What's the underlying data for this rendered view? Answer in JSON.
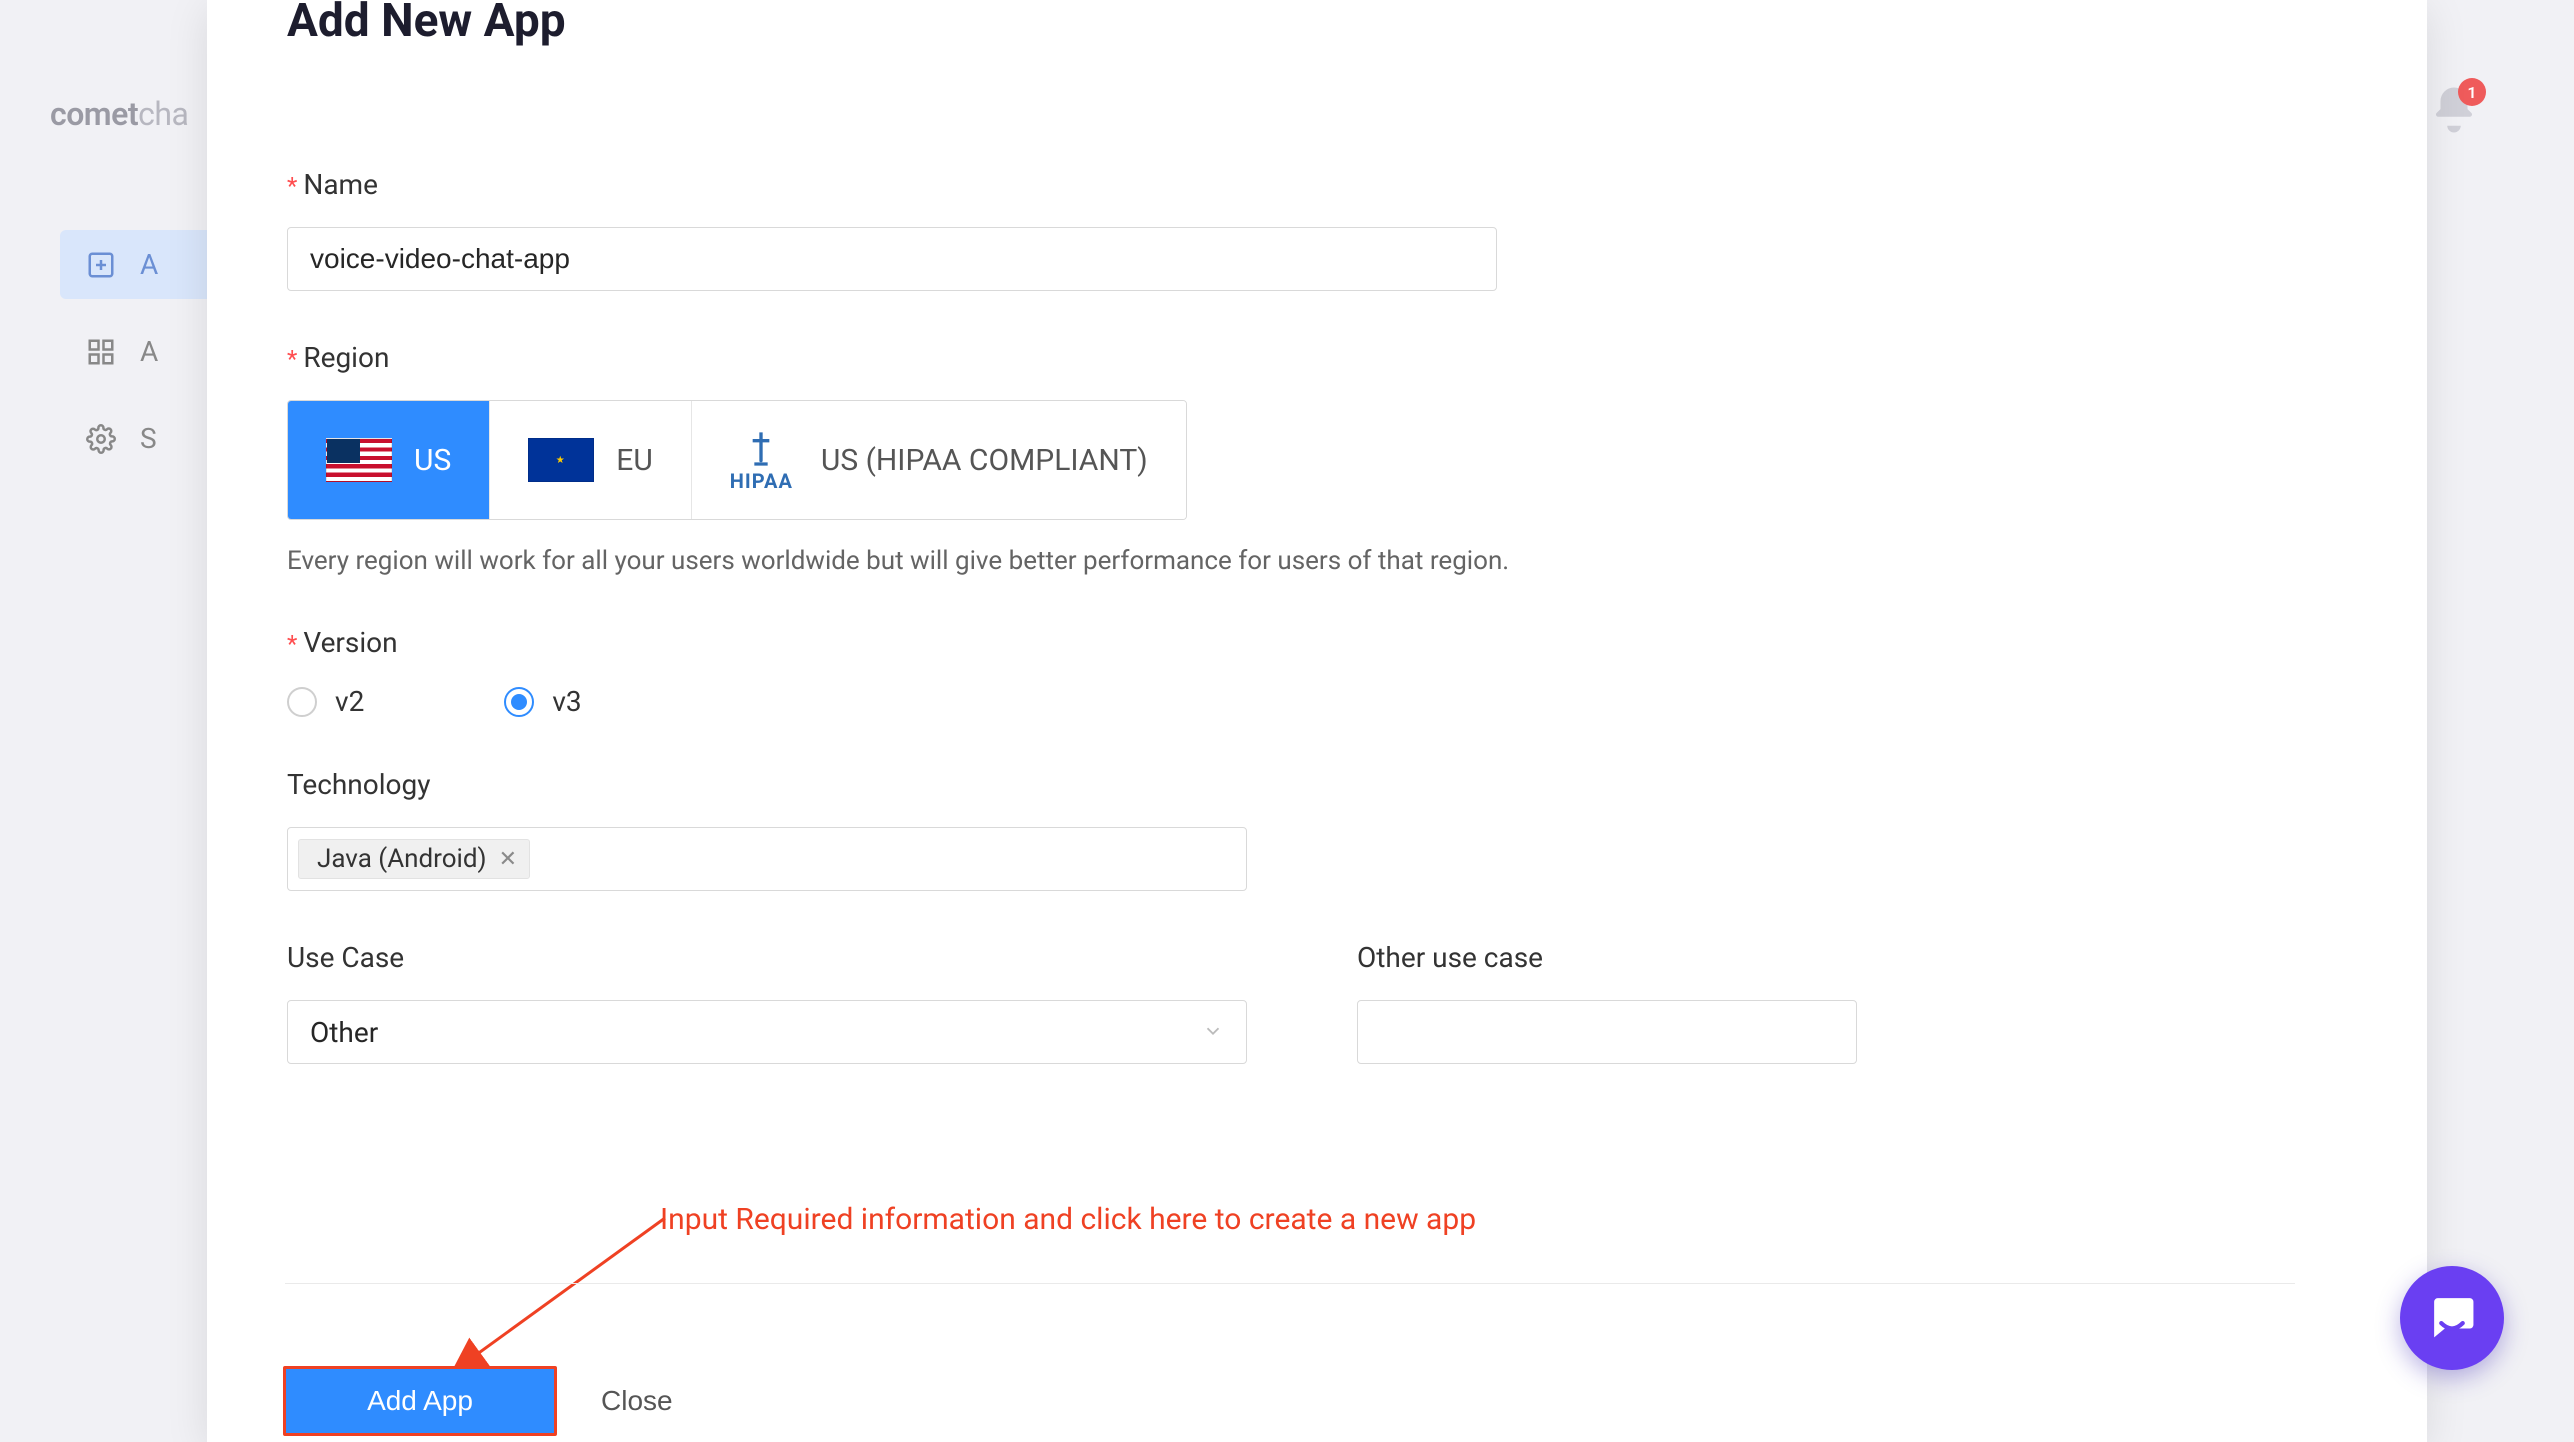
{
  "background": {
    "logo_primary": "comet",
    "logo_secondary": "cha",
    "sidebar": {
      "items": [
        {
          "label": "A",
          "active": true,
          "icon": "plus-square-icon"
        },
        {
          "label": "A",
          "active": false,
          "icon": "apps-grid-icon"
        },
        {
          "label": "S",
          "active": false,
          "icon": "gear-icon"
        }
      ]
    },
    "notifications_count": "1"
  },
  "modal": {
    "title": "Add New App",
    "name": {
      "label": "Name",
      "required": true,
      "value": "voice-video-chat-app"
    },
    "region": {
      "label": "Region",
      "required": true,
      "options": [
        {
          "code": "US",
          "label": "US",
          "selected": true
        },
        {
          "code": "EU",
          "label": "EU",
          "selected": false
        },
        {
          "code": "US_HIPAA",
          "label": "US (HIPAA COMPLIANT)",
          "selected": false,
          "hipaa_label": "HIPAA"
        }
      ],
      "hint": "Every region will work for all your users worldwide but will give better performance for users of that region."
    },
    "version": {
      "label": "Version",
      "required": true,
      "options": [
        {
          "value": "v2",
          "label": "v2",
          "selected": false
        },
        {
          "value": "v3",
          "label": "v3",
          "selected": true
        }
      ]
    },
    "technology": {
      "label": "Technology",
      "tags": [
        {
          "label": "Java (Android)"
        }
      ]
    },
    "use_case": {
      "label": "Use Case",
      "value": "Other"
    },
    "other_use_case": {
      "label": "Other use case",
      "value": ""
    },
    "actions": {
      "add_label": "Add App",
      "close_label": "Close"
    }
  },
  "annotation": {
    "text": "Input Required information and click here to create a new app"
  }
}
